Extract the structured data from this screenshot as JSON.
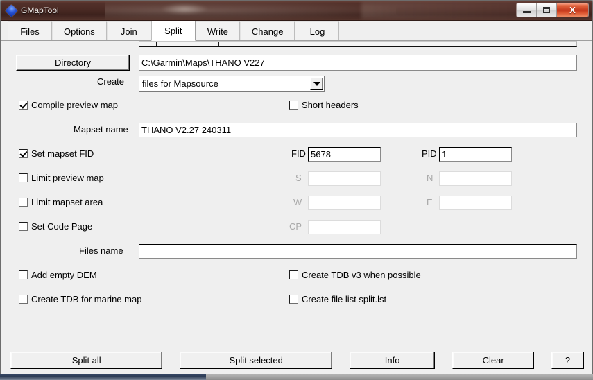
{
  "window": {
    "title": "GMapTool",
    "app_icon": "diamond-icon",
    "controls": {
      "minimize": "minimize-icon",
      "maximize": "maximize-icon",
      "close": "X"
    }
  },
  "tabs": [
    {
      "label": "Files",
      "active": false
    },
    {
      "label": "Options",
      "active": false
    },
    {
      "label": "Join",
      "active": false
    },
    {
      "label": "Split",
      "active": true
    },
    {
      "label": "Write",
      "active": false
    },
    {
      "label": "Change",
      "active": false
    },
    {
      "label": "Log",
      "active": false
    }
  ],
  "form": {
    "directory_button": "Directory",
    "directory_path": "C:\\Garmin\\Maps\\THANO V227",
    "create_label": "Create",
    "create_value": "files for Mapsource",
    "create_options": [
      "files for Mapsource"
    ],
    "compile_preview_map": {
      "label": "Compile preview map",
      "checked": true
    },
    "short_headers": {
      "label": "Short headers",
      "checked": false
    },
    "mapset_name_label": "Mapset name",
    "mapset_name_value": "THANO V2.27 240311",
    "set_mapset_fid": {
      "label": "Set mapset FID",
      "checked": true
    },
    "fid_label": "FID",
    "fid_value": "5678",
    "pid_label": "PID",
    "pid_value": "1",
    "limit_preview_map": {
      "label": "Limit preview map",
      "checked": false
    },
    "s_label": "S",
    "s_value": "",
    "n_label": "N",
    "n_value": "",
    "limit_mapset_area": {
      "label": "Limit mapset area",
      "checked": false
    },
    "w_label": "W",
    "w_value": "",
    "e_label": "E",
    "e_value": "",
    "set_code_page": {
      "label": "Set Code Page",
      "checked": false
    },
    "cp_label": "CP",
    "cp_value": "",
    "files_name_label": "Files name",
    "files_name_value": "",
    "add_empty_dem": {
      "label": "Add empty DEM",
      "checked": false
    },
    "create_tdb_v3": {
      "label": "Create TDB v3 when possible",
      "checked": false
    },
    "create_tdb_marine": {
      "label": "Create TDB for marine map",
      "checked": false
    },
    "create_file_list": {
      "label": "Create file list split.lst",
      "checked": false
    }
  },
  "buttons": {
    "split_all": "Split all",
    "split_selected": "Split selected",
    "info": "Info",
    "clear": "Clear",
    "help": "?"
  },
  "colors": {
    "titlebar_dark": "#4a2a24",
    "close_red": "#c4381c",
    "face": "#efefef",
    "accent_blue": "#2a56d8"
  }
}
